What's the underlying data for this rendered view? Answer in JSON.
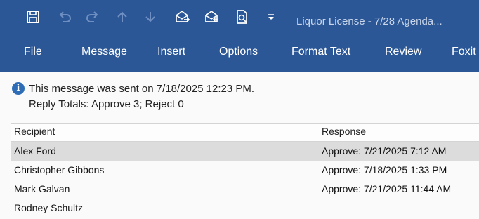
{
  "window": {
    "title": "Liquor License - 7/28 Agenda..."
  },
  "quick_access": [
    {
      "name": "save-icon"
    },
    {
      "name": "undo-icon"
    },
    {
      "name": "redo-icon"
    },
    {
      "name": "up-arrow-icon"
    },
    {
      "name": "down-arrow-icon"
    },
    {
      "name": "reply-icon"
    },
    {
      "name": "forward-icon"
    },
    {
      "name": "print-preview-icon"
    },
    {
      "name": "customize-dropdown-icon"
    }
  ],
  "tabs": [
    "File",
    "Message",
    "Insert",
    "Options",
    "Format Text",
    "Review",
    "Foxit"
  ],
  "info": {
    "sent": "This message was sent on 7/18/2025 12:23 PM.",
    "totals": "Reply Totals: Approve 3; Reject 0"
  },
  "tracking": {
    "headers": [
      "Recipient",
      "Response"
    ],
    "rows": [
      {
        "recipient": "Alex Ford",
        "response": "Approve: 7/21/2025 7:12 AM",
        "selected": true
      },
      {
        "recipient": "Christopher Gibbons",
        "response": "Approve: 7/18/2025 1:33 PM",
        "selected": false
      },
      {
        "recipient": "Mark Galvan",
        "response": "Approve: 7/21/2025 11:44 AM",
        "selected": false
      },
      {
        "recipient": "Rodney Schultz",
        "response": "",
        "selected": false
      }
    ]
  },
  "colors": {
    "ribbon": "#2b5797",
    "info_icon": "#2e6db6",
    "selected_row": "#dcdcdc"
  }
}
